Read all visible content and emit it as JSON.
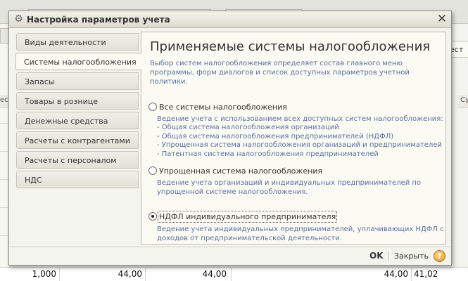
{
  "background": {
    "right_button": "ест",
    "left_header": "ес",
    "right_header": "Су",
    "bottom_row": [
      "1,000",
      "44,00",
      "44,00",
      "44,00",
      "41,02"
    ]
  },
  "dialog": {
    "title": "Настройка параметров учета",
    "icons": {
      "title": "gear-icon",
      "close": "close-icon",
      "help": "help-icon"
    }
  },
  "tabs": [
    {
      "label": "Виды деятельности",
      "active": false
    },
    {
      "label": "Системы налогообложения",
      "active": true
    },
    {
      "label": "Запасы",
      "active": false
    },
    {
      "label": "Товары в рознице",
      "active": false
    },
    {
      "label": "Денежные средства",
      "active": false
    },
    {
      "label": "Расчеты с контрагентами",
      "active": false
    },
    {
      "label": "Расчеты с персоналом",
      "active": false
    },
    {
      "label": "НДС",
      "active": false
    }
  ],
  "panel": {
    "heading": "Применяемые системы налогообложения",
    "description": "Выбор систем налогообложения определяет состав главного меню программы, форм диалогов и список доступных параметров учетной политики.",
    "options": [
      {
        "label": "Все системы налогообложения",
        "checked": false,
        "notes": [
          "Ведение учета с использованием всех доступных систем налогообложения:",
          "- Общая система налогообложения организаций",
          "- Общая система налогообложения предпринимателей (НДФЛ)",
          "- Упрощенная система налогообложения организаций и предпринимателей",
          "- Патентная система налогообложения предпринимателей"
        ]
      },
      {
        "label": "Упрощенная система налогообложения",
        "checked": false,
        "notes": [
          "Ведение учета организаций и индивидуальных предпринимателей по",
          "упрощенной системе налогообложения."
        ]
      },
      {
        "label": "НДФЛ индивидуального предпринимателя",
        "checked": true,
        "notes": [
          "Ведение учета индивидуальных предпринимателей, уплачивающих НДФЛ с",
          "доходов от предпринимательской деятельности."
        ]
      }
    ]
  },
  "footer": {
    "ok": "OK",
    "close": "Закрыть",
    "help": "?"
  }
}
